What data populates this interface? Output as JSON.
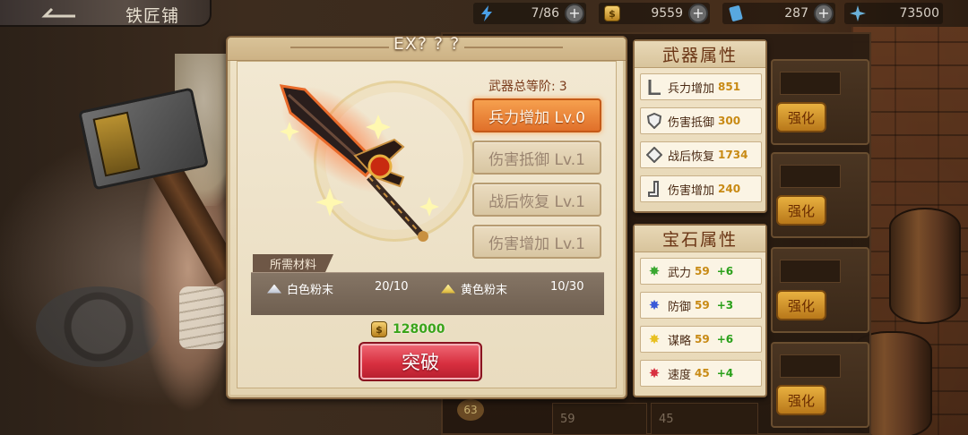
{
  "header": {
    "back_icon": "back-arrow-icon",
    "title": "铁匠铺",
    "resources": [
      {
        "icon": "lightning-icon",
        "value": "7/86",
        "color": "#4aa0e8"
      },
      {
        "icon": "coin-icon",
        "value": "9559",
        "color": "#e8b030"
      },
      {
        "icon": "ticket-icon",
        "value": "287",
        "color": "#58a8e0"
      },
      {
        "icon": "crystal-icon",
        "value": "73500",
        "color": "#6ab0d8"
      }
    ]
  },
  "dialog": {
    "title": "EX? ? ?",
    "total_grade_label": "武器总等阶:",
    "total_grade_value": "3",
    "enhance_options": [
      {
        "label": "兵力增加 Lv.0",
        "active": true
      },
      {
        "label": "伤害抵御 Lv.1",
        "active": false
      },
      {
        "label": "战后恢复 Lv.1",
        "active": false
      },
      {
        "label": "伤害增加 Lv.1",
        "active": false
      }
    ],
    "materials": {
      "label": "所需材料",
      "items": [
        {
          "name": "白色粉末",
          "count": "20/10"
        },
        {
          "name": "黄色粉末",
          "count": "10/30"
        }
      ]
    },
    "cost": "128000",
    "breakthrough_label": "突破"
  },
  "weapon_stats": {
    "title": "武器属性",
    "rows": [
      {
        "icon": "sword-stat-icon",
        "name": "兵力增加",
        "value": "851"
      },
      {
        "icon": "shield-stat-icon",
        "name": "伤害抵御",
        "value": "300"
      },
      {
        "icon": "heal-stat-icon",
        "name": "战后恢复",
        "value": "1734"
      },
      {
        "icon": "damage-stat-icon",
        "name": "伤害增加",
        "value": "240"
      }
    ]
  },
  "gem_stats": {
    "title": "宝石属性",
    "rows": [
      {
        "icon": "green-gem-icon",
        "color": "#3aa830",
        "name": "武力",
        "value": "59",
        "bonus": "+6"
      },
      {
        "icon": "blue-gem-icon",
        "color": "#3a5ad8",
        "name": "防御",
        "value": "59",
        "bonus": "+3"
      },
      {
        "icon": "yellow-gem-icon",
        "color": "#e8c020",
        "name": "谋略",
        "value": "59",
        "bonus": "+6"
      },
      {
        "icon": "red-gem-icon",
        "color": "#d83040",
        "name": "速度",
        "value": "45",
        "bonus": "+4"
      }
    ]
  },
  "background": {
    "upgrade_label": "强化",
    "level_badge": "63",
    "bottom_values": [
      "59",
      "45"
    ]
  }
}
